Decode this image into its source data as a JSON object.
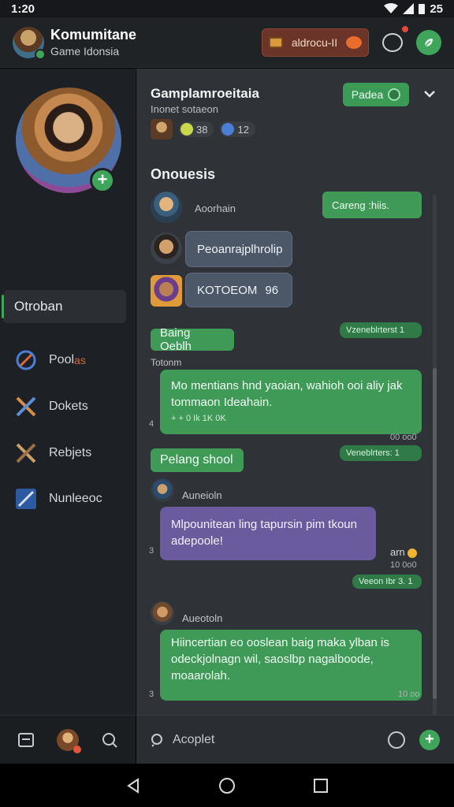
{
  "status_bar": {
    "time": "1:20",
    "battery": "25"
  },
  "header": {
    "title": "Komumitane",
    "subtitle": "Game Idonsia",
    "coins": "aldrocu-II",
    "icons": [
      "chat-bubble-icon",
      "leaf-icon"
    ]
  },
  "sidebar": {
    "section": "Otroban",
    "items": [
      {
        "label": "Pool",
        "badge": "as",
        "icon": "compass-icon"
      },
      {
        "label": "Dokets",
        "icon": "crossed-swords-icon"
      },
      {
        "label": "Rebjets",
        "icon": "crossed-swords-icon"
      },
      {
        "label": "Nunleeoc",
        "icon": "blade-icon"
      }
    ]
  },
  "chat": {
    "title": "Gamplamroeitaia",
    "subtitle": "Inonet sotaeon",
    "stats": {
      "a": "38",
      "b": "12"
    },
    "follow_label": "Padea",
    "section": "Onouesis",
    "messages": [
      {
        "name": "Aoorhain",
        "reply": "Careng :hiis."
      },
      {
        "text": "Peoanrajplhrolip"
      },
      {
        "text": "KOTOEOM",
        "extra": "96"
      },
      {
        "pill": "Baing Oeblh",
        "meta": "Vzeneblrterst 1",
        "sub": "Totonm",
        "body": "Mo mentians hnd yaoian, wahioh ooi aliy jak tommaon Ideahain.",
        "footnote": "+ + 0 Ik 1K 0K",
        "ts": "00 oo0",
        "idx": "4"
      },
      {
        "pill": "Pelang shool",
        "meta": "Veneblrters: 1",
        "name": "Auneioln",
        "body": "Mlpounitean ling tapursin pim tkoun adepoole!",
        "reaction": "arn",
        "ts": "10 0o0",
        "idx": "3",
        "meta2": "Veeon Ibr 3. 1"
      },
      {
        "name": "Aueotoln",
        "body": "Hiincertian eo ooslean baig maka ylban is odeckjolnagn wil, saoslbp nagalboode, moaarolah.",
        "ts": "10 oo",
        "idx": "3"
      }
    ],
    "composer_placeholder": "Acoplet"
  },
  "colors": {
    "accent": "#3ea55a",
    "panel": "#2f3236",
    "sidebar": "#1d2024",
    "purple": "#6a5a9e"
  }
}
